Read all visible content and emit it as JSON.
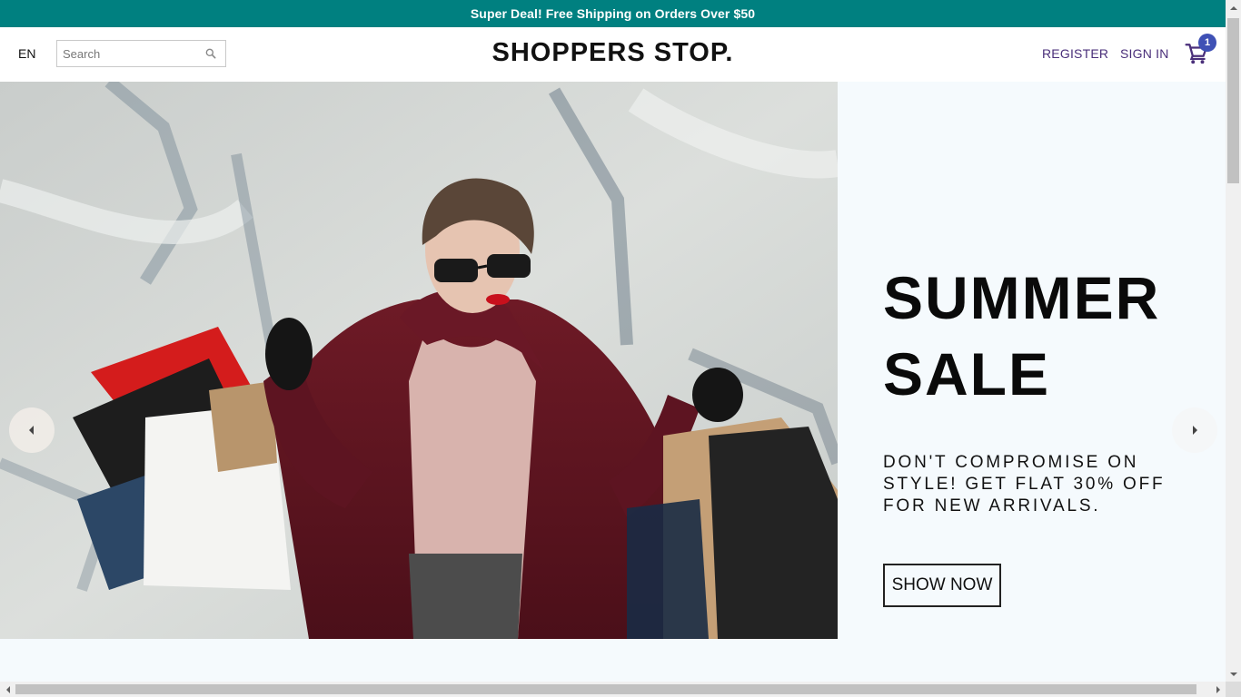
{
  "announcement": {
    "text": "Super Deal! Free Shipping on Orders Over $50",
    "background": "#008080"
  },
  "navbar": {
    "language": "EN",
    "search": {
      "placeholder": "Search",
      "value": "",
      "icon": "search-icon"
    },
    "logo": "SHOPPERS STOP.",
    "links": {
      "register": "REGISTER",
      "sign_in": "SIGN IN"
    },
    "cart": {
      "icon": "shopping-cart-icon",
      "count": "1",
      "badge_color": "#3f51b5"
    },
    "link_color": "#4a2f7a"
  },
  "slider": {
    "current_slide": {
      "image": "woman-with-shopping-bags-photo",
      "title_line1": "SUMMER",
      "title_line2": "SALE",
      "description": "DON'T COMPROMISE ON STYLE! GET FLAT 30% OFF FOR NEW ARRIVALS.",
      "button_label": "SHOW NOW"
    },
    "prev_icon": "arrow-left-icon",
    "next_icon": "arrow-right-icon",
    "background": "#f5fafd"
  }
}
